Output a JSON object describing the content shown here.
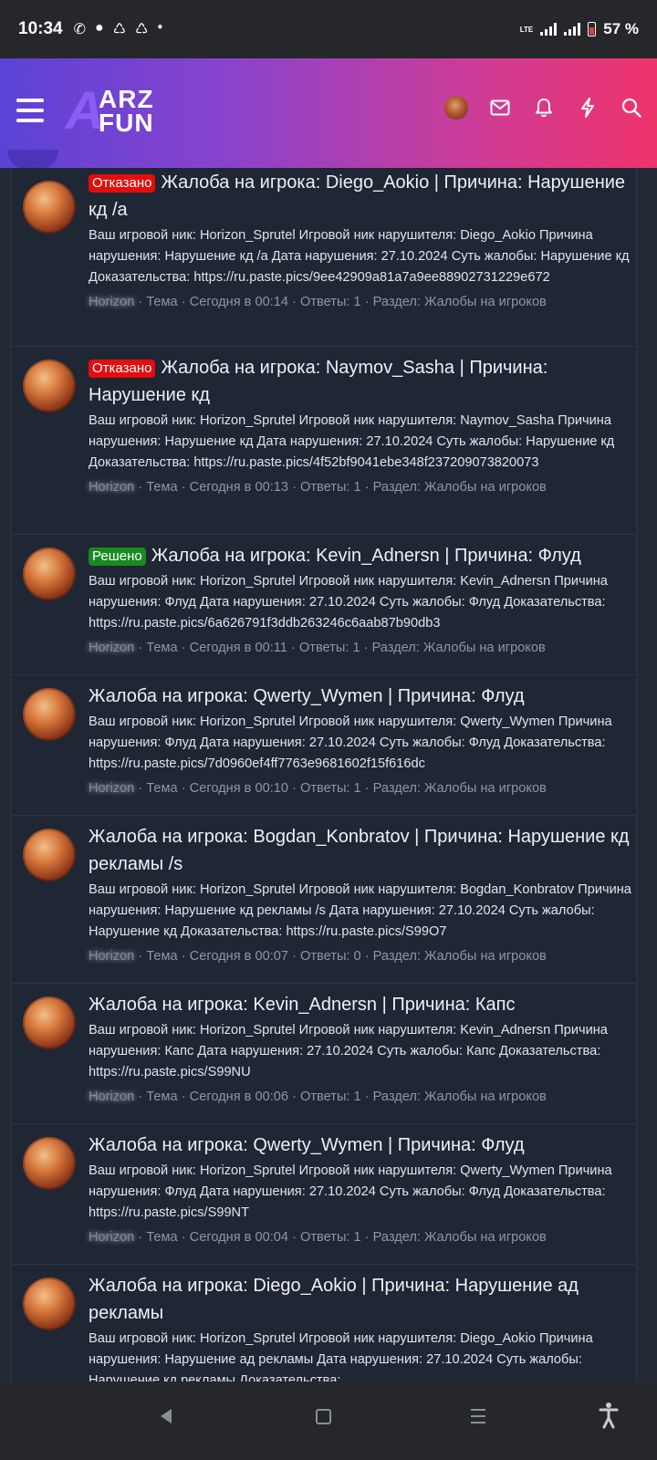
{
  "status_bar": {
    "time": "10:34",
    "battery": "57 %",
    "network": "LTE"
  },
  "header": {
    "logo_line1": "ARZ",
    "logo_line2": "FUN",
    "logo_letter": "A"
  },
  "threads": [
    {
      "badge": "Отказано",
      "badge_color": "#e30d0d",
      "title": "Жалоба на игрока: Diego_Aokio | Причина: Нарушение кд /а",
      "snippet": "Ваш игровой ник: Horizon_Sprutel Игровой ник нарушителя: Diego_Aokio Причина нарушения: Нарушение кд /а Дата нарушения: 27.10.2024 Суть жалобы: Нарушение кд Доказательства: https://ru.paste.pics/9ee42909a81a7a9ee88902731229e672",
      "author": "Horizon",
      "type": "Тема",
      "time": "Сегодня в 00:14",
      "replies": "Ответы: 1",
      "section": "Раздел: Жалобы на игроков"
    },
    {
      "badge": "Отказано",
      "badge_color": "#e30d0d",
      "title": "Жалоба на игрока: Naymov_Sasha | Причина: Нарушение кд",
      "snippet": "Ваш игровой ник: Horizon_Sprutel Игровой ник нарушителя: Naymov_Sasha Причина нарушения: Нарушение кд Дата нарушения: 27.10.2024 Суть жалобы: Нарушение кд Доказательства: https://ru.paste.pics/4f52bf9041ebe348f237209073820073",
      "author": "Horizon",
      "type": "Тема",
      "time": "Сегодня в 00:13",
      "replies": "Ответы: 1",
      "section": "Раздел: Жалобы на игроков"
    },
    {
      "badge": "Решено",
      "badge_color": "#178a22",
      "title": "Жалоба на игрока: Kevin_Adnersn | Причина: Флуд",
      "snippet": "Ваш игровой ник: Horizon_Sprutel Игровой ник нарушителя: Kevin_Adnersn Причина нарушения: Флуд Дата нарушения: 27.10.2024 Суть жалобы: Флуд Доказательства: https://ru.paste.pics/6a626791f3ddb263246c6aab87b90db3",
      "author": "Horizon",
      "type": "Тема",
      "time": "Сегодня в 00:11",
      "replies": "Ответы: 1",
      "section": "Раздел: Жалобы на игроков"
    },
    {
      "badge": "",
      "badge_color": "",
      "title": "Жалоба на игрока: Qwerty_Wymen | Причина: Флуд",
      "snippet": "Ваш игровой ник: Horizon_Sprutel Игровой ник нарушителя: Qwerty_Wymen Причина нарушения: Флуд Дата нарушения: 27.10.2024 Суть жалобы: Флуд Доказательства: https://ru.paste.pics/7d0960ef4ff7763e9681602f15f616dc",
      "author": "Horizon",
      "type": "Тема",
      "time": "Сегодня в 00:10",
      "replies": "Ответы: 1",
      "section": "Раздел: Жалобы на игроков"
    },
    {
      "badge": "",
      "badge_color": "",
      "title": "Жалоба на игрока: Bogdan_Konbratov | Причина: Нарушение кд рекламы /s",
      "snippet": "Ваш игровой ник: Horizon_Sprutel Игровой ник нарушителя: Bogdan_Konbratov Причина нарушения: Нарушение кд рекламы /s Дата нарушения: 27.10.2024 Суть жалобы: Нарушение кд Доказательства: https://ru.paste.pics/S99O7",
      "author": "Horizon",
      "type": "Тема",
      "time": "Сегодня в 00:07",
      "replies": "Ответы: 0",
      "section": "Раздел: Жалобы на игроков"
    },
    {
      "badge": "",
      "badge_color": "",
      "title": "Жалоба на игрока: Kevin_Adnersn | Причина: Капс",
      "snippet": "Ваш игровой ник: Horizon_Sprutel Игровой ник нарушителя: Kevin_Adnersn Причина нарушения: Капс Дата нарушения: 27.10.2024 Суть жалобы: Капс Доказательства: https://ru.paste.pics/S99NU",
      "author": "Horizon",
      "type": "Тема",
      "time": "Сегодня в 00:06",
      "replies": "Ответы: 1",
      "section": "Раздел: Жалобы на игроков"
    },
    {
      "badge": "",
      "badge_color": "",
      "title": "Жалоба на игрока: Qwerty_Wymen | Причина: Флуд",
      "snippet": "Ваш игровой ник: Horizon_Sprutel Игровой ник нарушителя: Qwerty_Wymen Причина нарушения: Флуд Дата нарушения: 27.10.2024 Суть жалобы: Флуд Доказательства: https://ru.paste.pics/S99NT",
      "author": "Horizon",
      "type": "Тема",
      "time": "Сегодня в 00:04",
      "replies": "Ответы: 1",
      "section": "Раздел: Жалобы на игроков"
    },
    {
      "badge": "",
      "badge_color": "",
      "title": "Жалоба на игрока: Diego_Aokio | Причина: Нарушение ад рекламы",
      "snippet": "Ваш игровой ник: Horizon_Sprutel Игровой ник нарушителя: Diego_Aokio Причина нарушения: Нарушение ад рекламы Дата нарушения: 27.10.2024 Суть жалобы: Нарушение кд рекламы Доказательства:",
      "author": "",
      "type": "",
      "time": "",
      "replies": "",
      "section": ""
    }
  ],
  "separator": "·",
  "colors": {
    "header_start": "#5b43d6",
    "header_end": "#f0336b",
    "background": "#1f2634",
    "refused": "#e30d0d",
    "solved": "#178a22"
  },
  "icons": [
    "hamburger-menu-icon",
    "mail-icon",
    "bell-icon",
    "lightning-icon",
    "search-icon"
  ]
}
